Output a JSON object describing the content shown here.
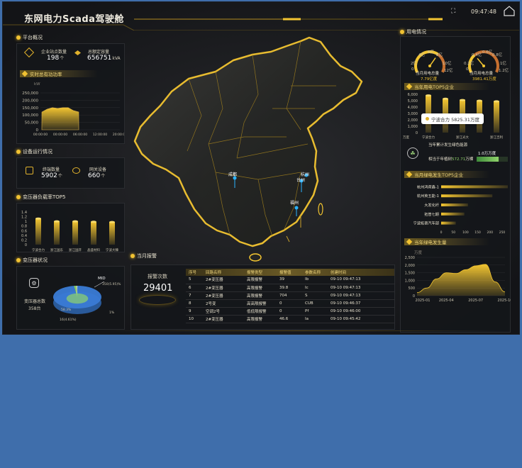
{
  "header": {
    "title": "东网电力Scada驾驶舱",
    "time": "09:47:48",
    "fullscreen_icon": "expand-icon",
    "home_icon": "home-icon"
  },
  "platform": {
    "title": "平台概况",
    "enterprise_label": "企业站点数量",
    "enterprise_value": "198",
    "enterprise_unit": "个",
    "capacity_label": "总额定容量",
    "capacity_value": "656751",
    "capacity_unit": "kVA",
    "realtime_title": "实时总有功功率",
    "realtime_unit": "kW"
  },
  "devices": {
    "title": "设备运行情况",
    "terminal_label": "终端数量",
    "terminal_value": "5902",
    "terminal_unit": "个",
    "gateway_label": "网关设备",
    "gateway_value": "660",
    "gateway_unit": "个"
  },
  "transformer_load": {
    "title": "变压器负载率TOP5"
  },
  "transformer_status": {
    "title": "变压器状况",
    "total_label": "变压器总数",
    "total_value": "358",
    "total_unit": "台",
    "legend_mid": "MID",
    "legend_mid_pct": "350(5.95)%",
    "pct_label": "58.3%",
    "legend_low": "1%",
    "legend_bottom": "16(4.61%)"
  },
  "alarm": {
    "title": "当月报警",
    "count_label": "报警次数",
    "count_value": "29401",
    "headers": [
      "序号",
      "回路名称",
      "报警类型",
      "报警值",
      "参数名称",
      "创建时间"
    ],
    "rows": [
      [
        "5",
        "2#变压器",
        "高限报警",
        "39",
        "Ib",
        "09-10 09:47:13"
      ],
      [
        "6",
        "2#变压器",
        "高限报警",
        "39.8",
        "Ic",
        "09-10 09:47:13"
      ],
      [
        "7",
        "2#变压器",
        "高限报警",
        "704",
        "S",
        "09-10 09:47:13"
      ],
      [
        "8",
        "2号变",
        "高高限报警",
        "0",
        "CUB",
        "09-10 09:46:37"
      ],
      [
        "9",
        "空调2号",
        "低低限报警",
        "0",
        "Pf",
        "09-10 09:46:00"
      ],
      [
        "10",
        "2#变压器",
        "高限报警",
        "46.6",
        "Ia",
        "09-10 09:45:42"
      ]
    ]
  },
  "map": {
    "city_chengdu": "成都",
    "city_hangzhou": "杭州",
    "city_taizhou": "台州",
    "city_fuzhou": "福州"
  },
  "electricity": {
    "title": "用电情况",
    "gauge1_label": "当月用电总量",
    "gauge1_value": "7.79亿度",
    "gauge2_label": "当月用电总量",
    "gauge2_value": "3981.41万度",
    "gauge1_ticks": [
      "2亿",
      "4亿",
      "6亿",
      "8亿",
      "10亿",
      "0",
      "12亿"
    ],
    "gauge2_ticks": [
      "0.2亿",
      "0.4亿",
      "0.6亿",
      "0.8亿",
      "1亿",
      "0",
      "1.2亿"
    ],
    "gauge1_level": 0.65,
    "gauge2_level": 0.33
  },
  "top5_usage": {
    "title": "当年用电TOP5企业",
    "tooltip": "宁波合力 5825.31万度",
    "unit_label": "万度",
    "x_labels": [
      "宁波合力",
      "浙江光大",
      "浙江吉利"
    ]
  },
  "green": {
    "title": "当年累计发生绿色能源",
    "equiv_label": "相当于年植树",
    "equiv_value": "572.71",
    "equiv_unit": "万棵",
    "saved_label": "1.0万万度"
  },
  "green_top5": {
    "title": "当月绿电发生TOP5企业"
  },
  "yearly_green": {
    "title": "当年绿电发生量",
    "unit_label": "万度"
  },
  "chart_data": [
    {
      "type": "area",
      "title": "实时总有功功率",
      "ylabel": "kW",
      "x": [
        "00:00",
        "00:00",
        "00:00",
        "06:00",
        "00:00",
        "12:00",
        "00:00",
        "20:00"
      ],
      "x_tick_labels": [
        "00:00:00",
        "00:00:00",
        "06:00:00",
        "12:00:00",
        "20:00:00"
      ],
      "values": [
        120000,
        140000,
        150000,
        145000,
        150000,
        150000,
        130000,
        120000
      ],
      "ylim": [
        0,
        250000
      ],
      "y_ticks": [
        "250,000",
        "200,000",
        "150,000",
        "100,000",
        "50,000",
        "0"
      ]
    },
    {
      "type": "bar",
      "title": "变压器负载率TOP5",
      "categories": [
        "宁波合力",
        "浙江国东",
        "浙江国开",
        "晶盛材料",
        "宁波大臻"
      ],
      "values": [
        1.12,
        1.0,
        1.0,
        0.98,
        0.97
      ],
      "ylim": [
        0,
        1.4
      ],
      "y_ticks": [
        "1.4",
        "1.2",
        "1",
        "0.8",
        "0.6",
        "0.4",
        "0.2",
        "0"
      ]
    },
    {
      "type": "pie",
      "title": "变压器状况",
      "slices": [
        {
          "label": "MID",
          "value": 350
        },
        {
          "label": "low",
          "value": 6
        },
        {
          "label": "other",
          "value": 2
        }
      ]
    },
    {
      "type": "bar",
      "title": "当年用电TOP5企业",
      "categories": [
        "宁波合力",
        "",
        "浙江光大",
        "",
        "浙江吉利"
      ],
      "values": [
        5825.31,
        5300,
        5100,
        5000,
        4900
      ],
      "ylim": [
        0,
        6000
      ],
      "y_ticks": [
        "6,000",
        "5,000",
        "4,000",
        "3,000",
        "2,000",
        "1,000",
        "0"
      ],
      "ylabel": "万度"
    },
    {
      "type": "bar",
      "title": "当月绿电发生TOP5企业",
      "categories": [
        "杭州鸿荷鑫-1",
        "杭州英五能-1",
        "大发化纤",
        "拓普七期",
        "宁波拓普汽车部"
      ],
      "values": [
        290,
        210,
        110,
        95,
        60
      ],
      "xlim": [
        0,
        250
      ],
      "x_ticks": [
        "0",
        "50",
        "100",
        "150",
        "200",
        "250"
      ]
    },
    {
      "type": "area",
      "title": "当年绿电发生量",
      "ylabel": "万度",
      "x": [
        "2025-01",
        "2025-02",
        "2025-03",
        "2025-04",
        "2025-05",
        "2025-06",
        "2025-07",
        "2025-08",
        "2025-09",
        "2025-10"
      ],
      "x_tick_labels": [
        "2025-01",
        "2025-04",
        "2025-07",
        "2025-10"
      ],
      "values": [
        200,
        500,
        1100,
        1500,
        1450,
        1700,
        1950,
        2050,
        900,
        250
      ],
      "ylim": [
        0,
        2500
      ],
      "y_ticks": [
        "2,500",
        "2,000",
        "1,500",
        "1,000",
        "500",
        "0"
      ]
    }
  ]
}
